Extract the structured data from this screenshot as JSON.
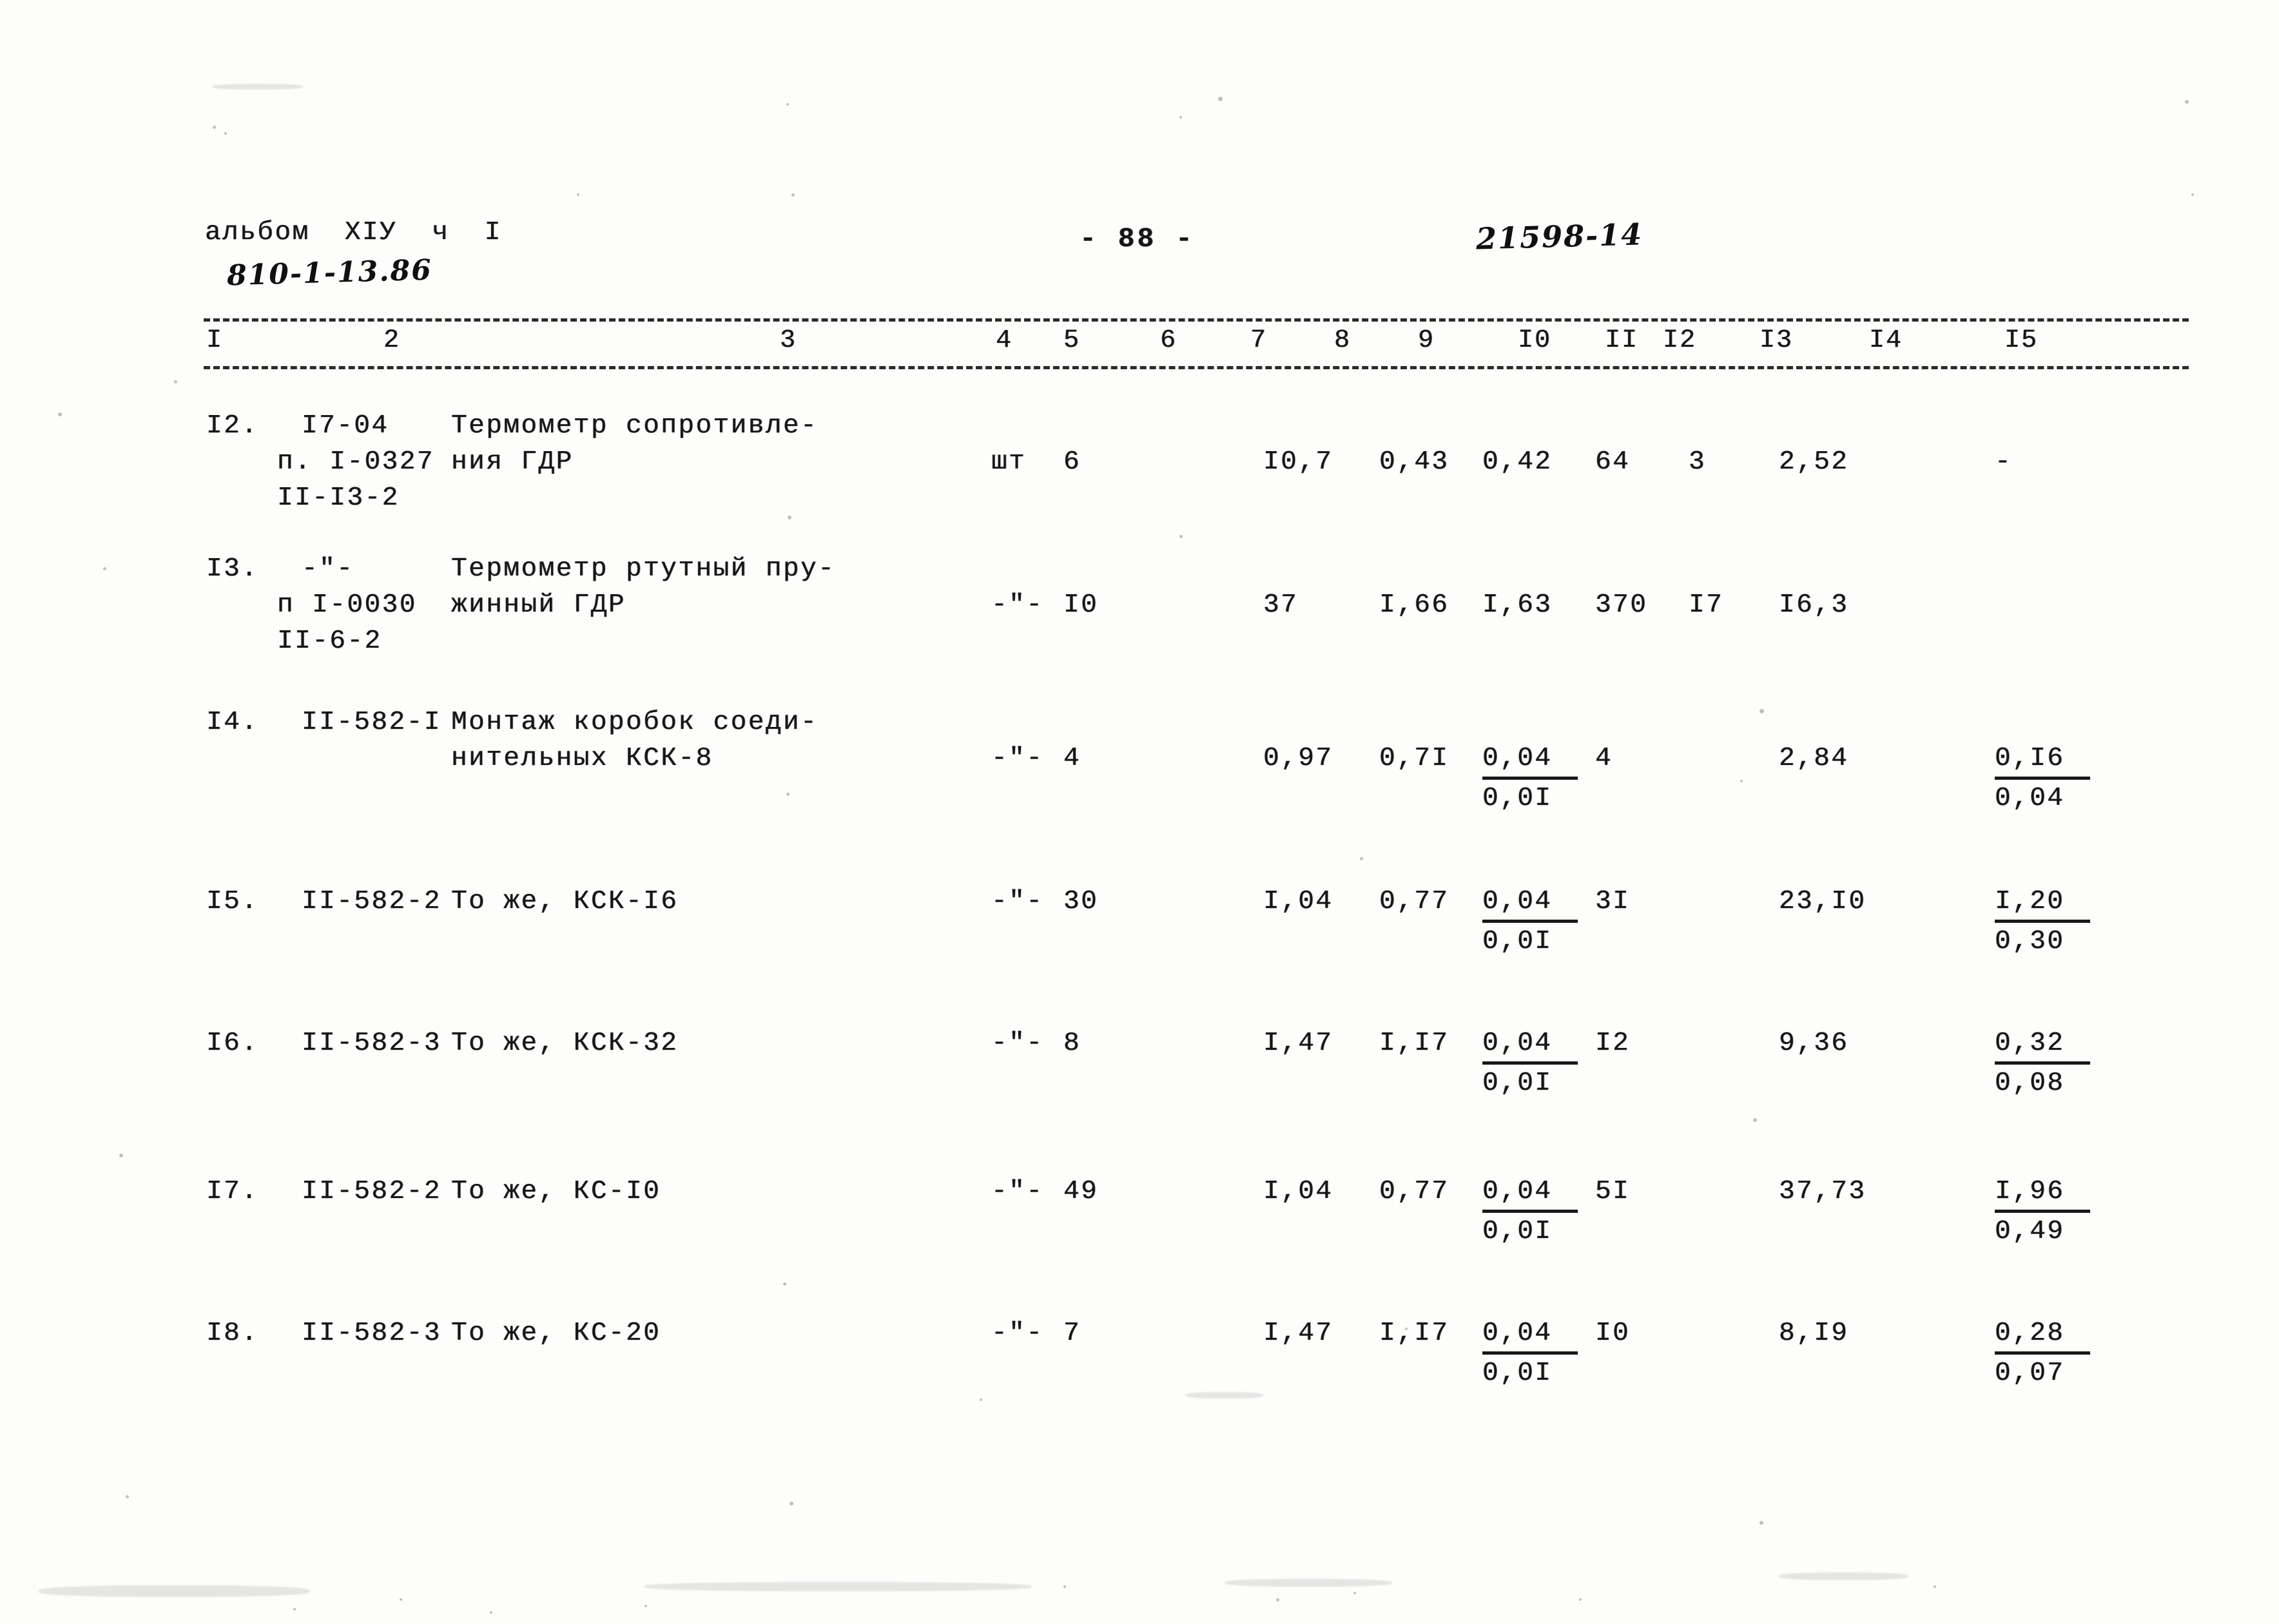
{
  "header": {
    "album_label": "альбом  XIУ  ч  I",
    "album_code": "810-1-13.86",
    "page_number": "- 88 -",
    "doc_code": "21598-14"
  },
  "table": {
    "column_numbers": [
      "I",
      "2",
      "3",
      "4",
      "5",
      "6",
      "7",
      "8",
      "9",
      "I0",
      "II",
      "I2",
      "I3",
      "I4",
      "I5"
    ],
    "rows": [
      {
        "no": "I2.",
        "code_lines": [
          "I7-04",
          "п. I-0327",
          "II-I3-2"
        ],
        "name_lines": [
          "Термометр сопротивле-",
          "ния ГДР"
        ],
        "unit": "шт",
        "qty": "6",
        "c8": "",
        "c9": "I0,7",
        "c10": "0,43",
        "c11_top": "0,42",
        "c11_bot": "",
        "c12": "64",
        "c13": "3",
        "c14": "2,52",
        "c15_top": "-",
        "c15_bot": ""
      },
      {
        "no": "I3.",
        "code_lines": [
          "-\"-",
          "п I-0030",
          "II-6-2"
        ],
        "name_lines": [
          "Термометр ртутный пру-",
          "жинный ГДР"
        ],
        "unit": "-\"-",
        "qty": "I0",
        "c8": "",
        "c9": "37",
        "c10": "I,66",
        "c11_top": "I,63",
        "c11_bot": "",
        "c12": "370",
        "c13": "I7",
        "c14": "I6,3",
        "c15_top": "",
        "c15_bot": ""
      },
      {
        "no": "I4.",
        "code_lines": [
          "II-582-I"
        ],
        "name_lines": [
          "Монтаж коробок соеди-",
          "нительных КСК-8"
        ],
        "unit": "-\"-",
        "qty": "4",
        "c8": "",
        "c9": "0,97",
        "c10": "0,7I",
        "c11_top": "0,04",
        "c11_bot": "0,0I",
        "c12": "4",
        "c13": "",
        "c14": "2,84",
        "c15_top": "0,I6",
        "c15_bot": "0,04"
      },
      {
        "no": "I5.",
        "code_lines": [
          "II-582-2"
        ],
        "name_lines": [
          "То же, КСК-I6"
        ],
        "unit": "-\"-",
        "qty": "30",
        "c8": "",
        "c9": "I,04",
        "c10": "0,77",
        "c11_top": "0,04",
        "c11_bot": "0,0I",
        "c12": "3I",
        "c13": "",
        "c14": "23,I0",
        "c15_top": "I,20",
        "c15_bot": "0,30"
      },
      {
        "no": "I6.",
        "code_lines": [
          "II-582-3"
        ],
        "name_lines": [
          "То же, КСК-32"
        ],
        "unit": "-\"-",
        "qty": "8",
        "c8": "",
        "c9": "I,47",
        "c10": "I,I7",
        "c11_top": "0,04",
        "c11_bot": "0,0I",
        "c12": "I2",
        "c13": "",
        "c14": "9,36",
        "c15_top": "0,32",
        "c15_bot": "0,08"
      },
      {
        "no": "I7.",
        "code_lines": [
          "II-582-2"
        ],
        "name_lines": [
          "То же, КС-I0"
        ],
        "unit": "-\"-",
        "qty": "49",
        "c8": "",
        "c9": "I,04",
        "c10": "0,77",
        "c11_top": "0,04",
        "c11_bot": "0,0I",
        "c12": "5I",
        "c13": "",
        "c14": "37,73",
        "c15_top": "I,96",
        "c15_bot": "0,49"
      },
      {
        "no": "I8.",
        "code_lines": [
          "II-582-3"
        ],
        "name_lines": [
          "То же, КС-20"
        ],
        "unit": "-\"-",
        "qty": "7",
        "c8": "",
        "c9": "I,47",
        "c10": "I,I7",
        "c11_top": "0,04",
        "c11_bot": "0,0I",
        "c12": "I0",
        "c13": "",
        "c14": "8,I9",
        "c15_top": "0,28",
        "c15_bot": "0,07"
      }
    ]
  }
}
